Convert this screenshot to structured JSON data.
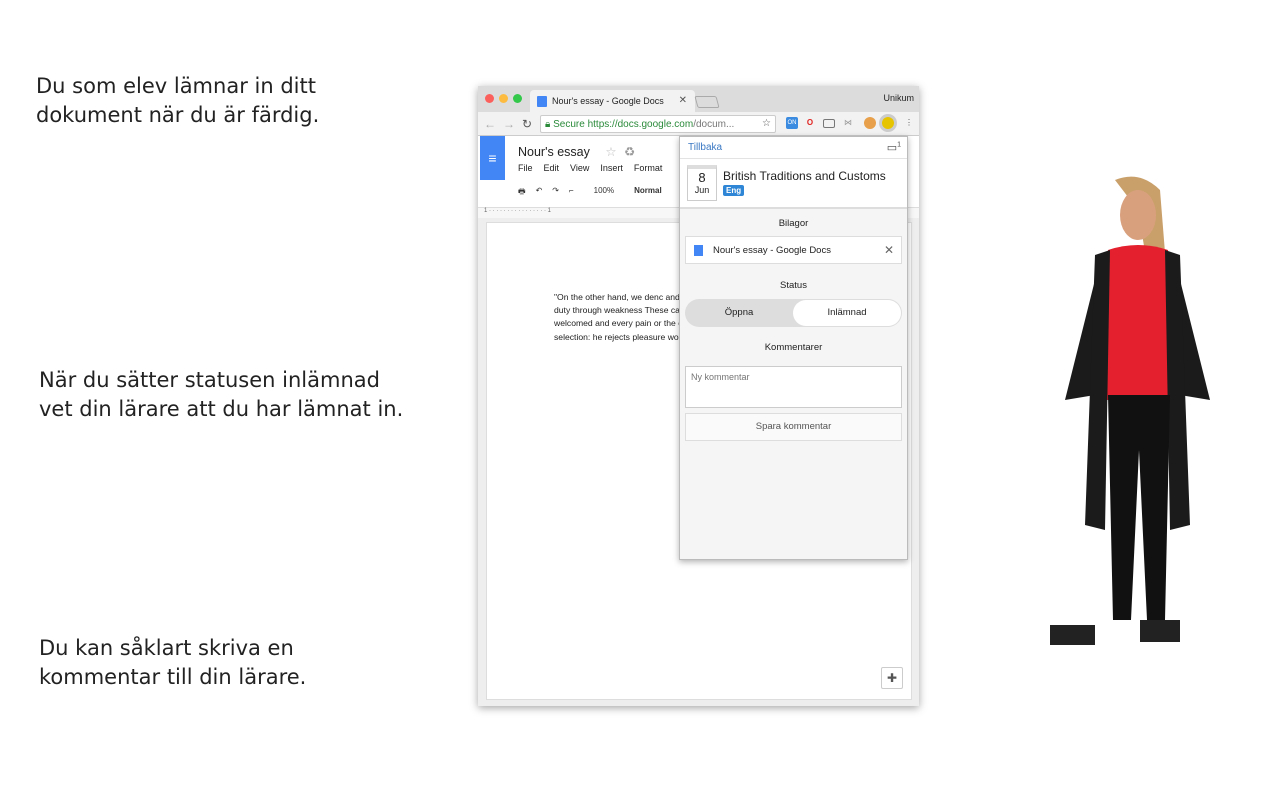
{
  "captions": [
    "Du som elev lämnar in ditt\ndokument när du är färdig.",
    "När du sätter statusen inlämnad\nvet din lärare att du har lämnat in.",
    "Du kan såklart skriva en\nkommentar till din lärare."
  ],
  "browser": {
    "tab_title": "Nour's essay - Google Docs",
    "profile": "Unikum",
    "secure_label": "Secure",
    "url_host": "https://docs.google.com",
    "url_rest": "/docum...",
    "ext_badge": "ON"
  },
  "docs": {
    "title": "Nour's essay",
    "menu": [
      "File",
      "Edit",
      "View",
      "Insert",
      "Format"
    ],
    "zoom": "100%",
    "style": "Normal",
    "ruler": "1 · · · · · · · · · · · · · · · · 1",
    "text": "\"On the other hand, we denc and demoralized by the char foresee the pain and trouble their duty through weakness These cases are perfectly sir untrammelled and when noth be welcomed and every pain or the obligations of business annoyances accepted. The v selection: he rejects pleasure worse pains.\""
  },
  "popup": {
    "back": "Tillbaka",
    "day": "8",
    "month": "Jun",
    "assignment": "British Traditions and Customs",
    "subject": "Eng",
    "attachments_heading": "Bilagor",
    "attachment": "Nour's essay - Google Docs",
    "status_heading": "Status",
    "status_options": [
      "Öppna",
      "Inlämnad"
    ],
    "status_selected": "Inlämnad",
    "comments_heading": "Kommentarer",
    "comment_placeholder": "Ny kommentar",
    "save_label": "Spara kommentar",
    "notif_count": "1"
  },
  "colors": {
    "accent": "#2f86d6",
    "docs_blue": "#4285f4",
    "link": "#3a78c3"
  }
}
